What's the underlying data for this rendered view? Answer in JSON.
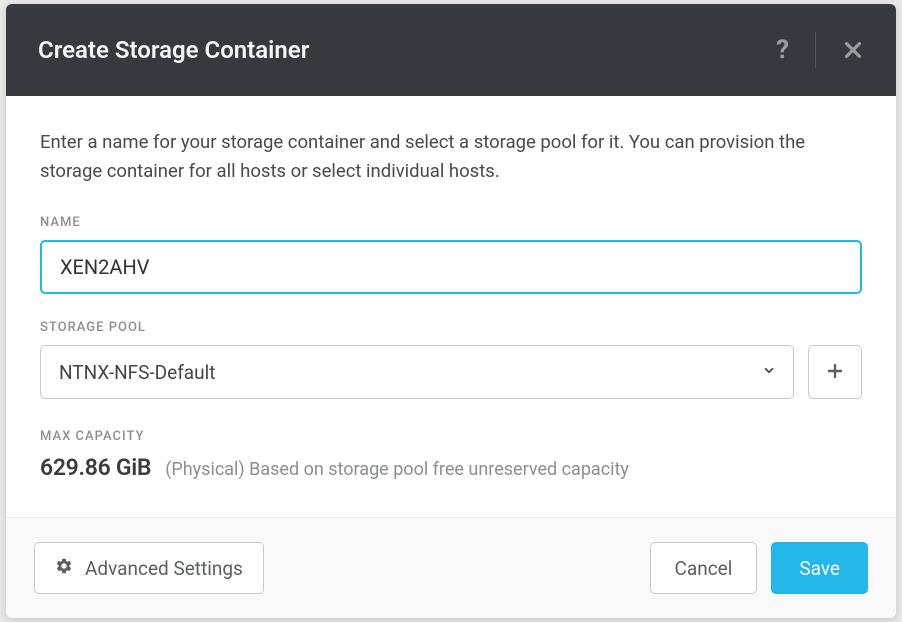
{
  "header": {
    "title": "Create Storage Container"
  },
  "body": {
    "description": "Enter a name for your storage container and select a storage pool for it. You can provision the storage container for all hosts or select individual hosts.",
    "name_label": "NAME",
    "name_value": "XEN2AHV",
    "storage_pool_label": "STORAGE POOL",
    "storage_pool_value": "NTNX-NFS-Default",
    "max_capacity_label": "MAX CAPACITY",
    "max_capacity_value": "629.86 GiB",
    "max_capacity_note": "(Physical) Based on storage pool free unreserved capacity"
  },
  "footer": {
    "advanced_label": "Advanced Settings",
    "cancel_label": "Cancel",
    "save_label": "Save"
  }
}
